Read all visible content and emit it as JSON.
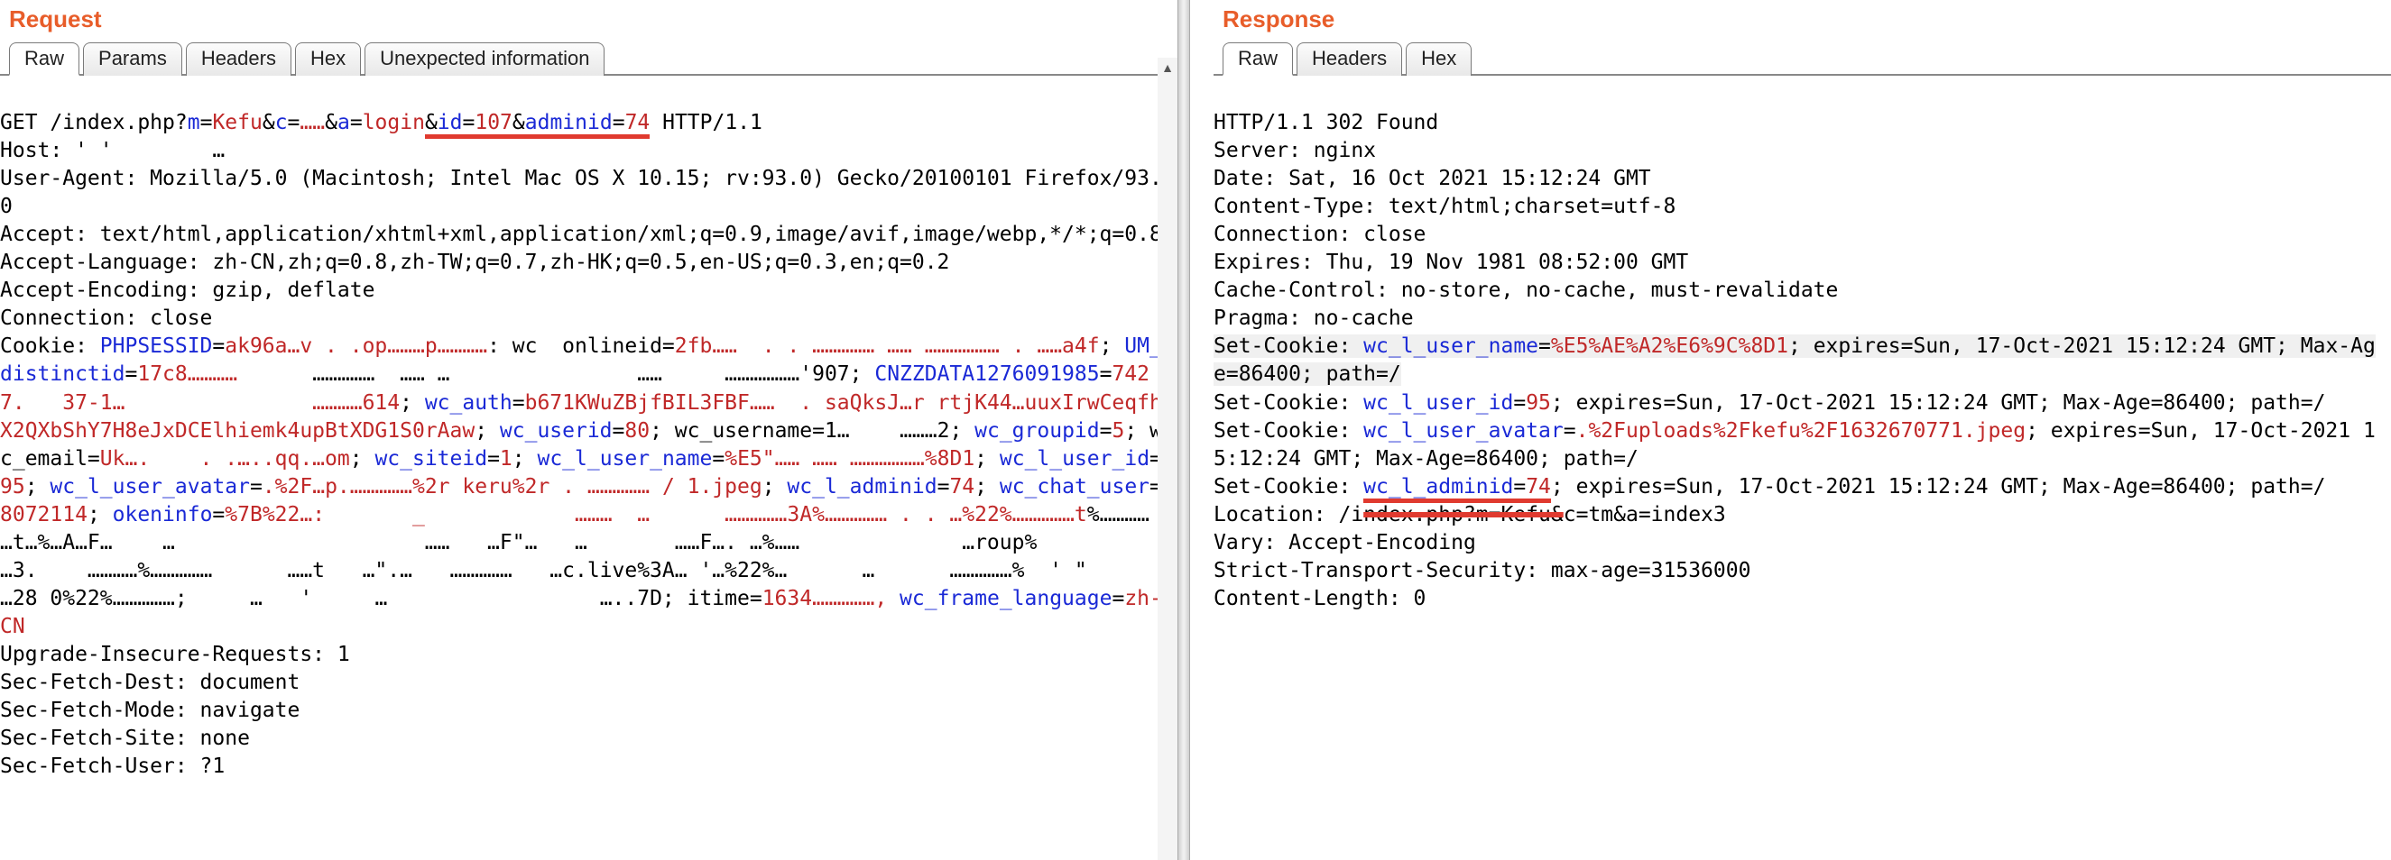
{
  "request": {
    "title": "Request",
    "tabs": [
      "Raw",
      "Params",
      "Headers",
      "Hex",
      "Unexpected information"
    ],
    "activeTab": "Raw",
    "firstLine": {
      "method": "GET ",
      "path_prefix": "/index.php?",
      "p1k": "m",
      "p1v": "Kefu",
      "amp1": "&",
      "p2k": "c",
      "p2v": "……",
      "amp2": "&",
      "p3k": "a",
      "p3v": "login",
      "amp3": "&",
      "p4k": "id",
      "p4v": "107",
      "amp4": "&",
      "p5k": "adminid",
      "p5v": "74",
      "proto": " HTTP/1.1"
    },
    "host_label": "Host: ",
    "host_value": "' '        …",
    "ua": "User-Agent: Mozilla/5.0 (Macintosh; Intel Mac OS X 10.15; rv:93.0) Gecko/20100101 Firefox/93.0",
    "accept": "Accept: text/html,application/xhtml+xml,application/xml;q=0.9,image/avif,image/webp,*/*;q=0.8",
    "accept_lang": "Accept-Language: zh-CN,zh;q=0.8,zh-TW;q=0.7,zh-HK;q=0.5,en-US;q=0.3,en;q=0.2",
    "accept_enc": "Accept-Encoding: gzip, deflate",
    "connection": "Connection: close",
    "cookie": {
      "label": "Cookie: ",
      "parts": [
        {
          "k": "PHPSESSID",
          "v": "ak96a…v . .op………p…………"
        },
        {
          "plain": ": wc  onlineid="
        },
        {
          "v2": "2fb……  . . …………… …… ……………… . ……a4f"
        },
        {
          "sep": "; "
        },
        {
          "k": "UM_distinctid",
          "v": "17c8…………"
        },
        {
          "plain": "      ……………  …… …               ……     ………………'907"
        },
        {
          "sep": "; "
        },
        {
          "k": "CNZZDATA1276091985",
          "v": "7427.   37-1…               …………614"
        },
        {
          "sep": "; "
        },
        {
          "k": "wc_auth",
          "v": "b671KWuZBjfBIL3FBF……  . saQksJ…r rtjK44…uuxIrwCeqfhX2QXbShY7H8eJxDCElhiemk4upBtXDG1S0rAaw"
        },
        {
          "sep": "; "
        },
        {
          "k": "wc_userid",
          "v": "80"
        },
        {
          "sep": "; "
        },
        {
          "plain": "wc_username=1…    ………2"
        },
        {
          "sep": "; "
        },
        {
          "k": "wc_groupid",
          "v": "5"
        },
        {
          "sep": "; "
        },
        {
          "plain": "wc_email="
        },
        {
          "v2": "Uk….    . .…..qq.…om"
        },
        {
          "sep": "; "
        },
        {
          "k": "wc_siteid",
          "v": "1"
        },
        {
          "sep": "; "
        },
        {
          "k": "wc_l_user_name",
          "v": "%E5\"…… …… ………………%8D1"
        },
        {
          "sep": "; "
        },
        {
          "k": "wc_l_user_id",
          "v": "95"
        },
        {
          "sep": "; "
        },
        {
          "k": "wc_l_user_avatar",
          "v": ".%2F…p.……………%2r keru%2r . …………… / 1.jpeg"
        },
        {
          "sep": "; "
        },
        {
          "k": "wc_l_adminid",
          "v": "74"
        },
        {
          "sep": "; "
        },
        {
          "k": "wc_chat_user",
          "v": "8072114"
        },
        {
          "sep": "; "
        },
        {
          "k": "okeninfo",
          "v": "%7B%22…:       _            ………  …      ……………3A%…………… . . …%22%……………t"
        },
        {
          "plain": "%…………   …t…%…A…F…    …                    ……   …F\"…   …       ……F…. …%……             …roup%           …3.    …………%……………      ……t   …\".…   ……………   …c.live%3A… '…%22%…      …      ……………%  ' \"         …28 0%22%……………"
        },
        {
          "sep": "; "
        },
        {
          "plain": "    …   '     …                 …..7D; itime="
        },
        {
          "v2": "1634……………,"
        },
        {
          "sep": " "
        },
        {
          "k": "wc_frame_language",
          "v": "zh-CN"
        }
      ]
    },
    "upgrade": "Upgrade-Insecure-Requests: 1",
    "sfd": "Sec-Fetch-Dest: document",
    "sfm": "Sec-Fetch-Mode: navigate",
    "sfs": "Sec-Fetch-Site: none",
    "sfu": "Sec-Fetch-User: ?1"
  },
  "response": {
    "title": "Response",
    "tabs": [
      "Raw",
      "Headers",
      "Hex"
    ],
    "activeTab": "Raw",
    "status": "HTTP/1.1 302 Found",
    "server": "Server: nginx",
    "date": "Date: Sat, 16 Oct 2021 15:12:24 GMT",
    "ctype": "Content-Type: text/html;charset=utf-8",
    "connection": "Connection: close",
    "expires": "Expires: Thu, 19 Nov 1981 08:52:00 GMT",
    "cache": "Cache-Control: no-store, no-cache, must-revalidate",
    "pragma": "Pragma: no-cache",
    "sc1": {
      "label": "Set-Cookie: ",
      "k": "wc_l_user_name",
      "v": "%E5%AE%A2%E6%9C%8D1",
      "tail": "; expires=Sun, 17-Oct-2021 15:12:24 GMT; Max-Age=86400; path=/"
    },
    "sc2": {
      "label": "Set-Cookie: ",
      "k": "wc_l_user_id",
      "v": "95",
      "tail": "; expires=Sun, 17-Oct-2021 15:12:24 GMT; Max-Age=86400; path=/"
    },
    "sc3": {
      "label": "Set-Cookie: ",
      "k": "wc_l_user_avatar",
      "v": ".%2Fuploads%2Fkefu%2F1632670771.jpeg",
      "tail": "; expires=Sun, 17-Oct-2021 15:12:24 GMT; Max-Age=86400; path=/"
    },
    "sc4": {
      "label": "Set-Cookie: ",
      "k": "wc_l_adminid",
      "v": "74",
      "tail": "; expires=Sun, 17-Oct-2021 15:12:24 GMT; Max-Age=86400; path=/"
    },
    "location": {
      "label": "Location: /i",
      "redacted": "ndex.php?m=Kefu&",
      "tail": "c=tm&a=index3"
    },
    "vary": "Vary: Accept-Encoding",
    "sts": "Strict-Transport-Security: max-age=31536000",
    "clen": "Content-Length: 0"
  }
}
